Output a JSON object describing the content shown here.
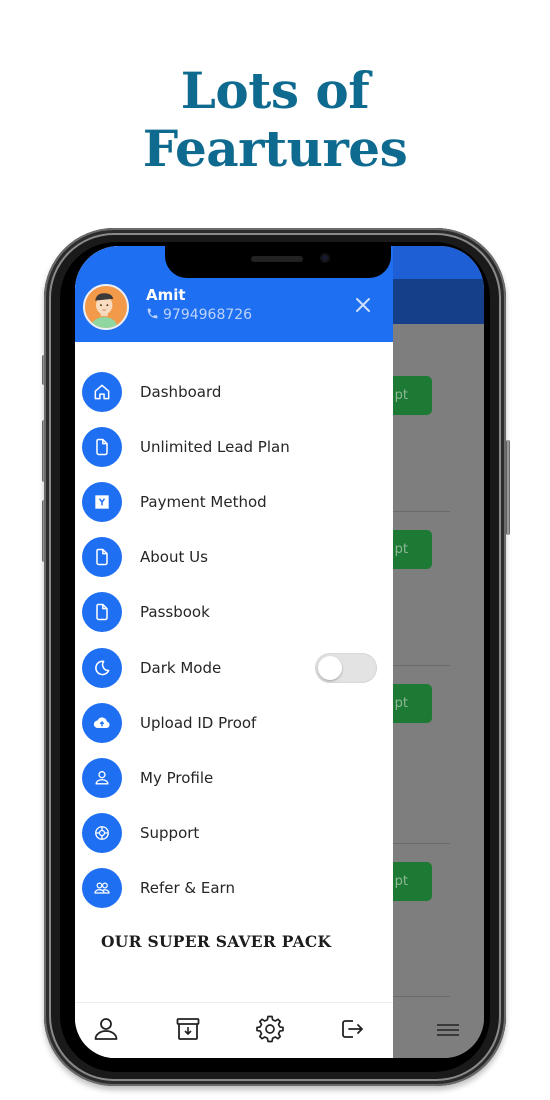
{
  "promo": {
    "title_line1": "Lots of",
    "title_line2": "Feartures",
    "title_color": "#0f6a8f"
  },
  "drawer": {
    "accent_color": "#1f6ff2",
    "user": {
      "name": "Amit",
      "phone": "9794968726",
      "avatar_icon": "user-avatar-illustration",
      "phone_icon": "phone-icon"
    },
    "close_icon": "close-icon",
    "menu_items": [
      {
        "label": "Dashboard",
        "icon": "home-icon"
      },
      {
        "label": "Unlimited Lead Plan",
        "icon": "document-icon"
      },
      {
        "label": "Payment Method",
        "icon": "payment-icon"
      },
      {
        "label": "About Us",
        "icon": "document-icon"
      },
      {
        "label": "Passbook",
        "icon": "document-icon"
      },
      {
        "label": "Dark Mode",
        "icon": "moon-icon",
        "toggle": false
      },
      {
        "label": "Upload ID Proof",
        "icon": "cloud-upload-icon"
      },
      {
        "label": "My Profile",
        "icon": "user-icon"
      },
      {
        "label": "Support",
        "icon": "lifebuoy-icon"
      },
      {
        "label": "Refer & Earn",
        "icon": "users-icon"
      }
    ],
    "section_heading": "OUR SUPER SAVER PACK",
    "bottom_bar": [
      {
        "icon": "profile-icon"
      },
      {
        "icon": "archive-download-icon"
      },
      {
        "icon": "settings-gear-icon"
      },
      {
        "icon": "logout-icon"
      }
    ]
  },
  "background_app": {
    "accept_button_partial_label": "pt",
    "accept_button_color": "#1d7a35",
    "menu_icon": "hamburger-menu-icon"
  }
}
